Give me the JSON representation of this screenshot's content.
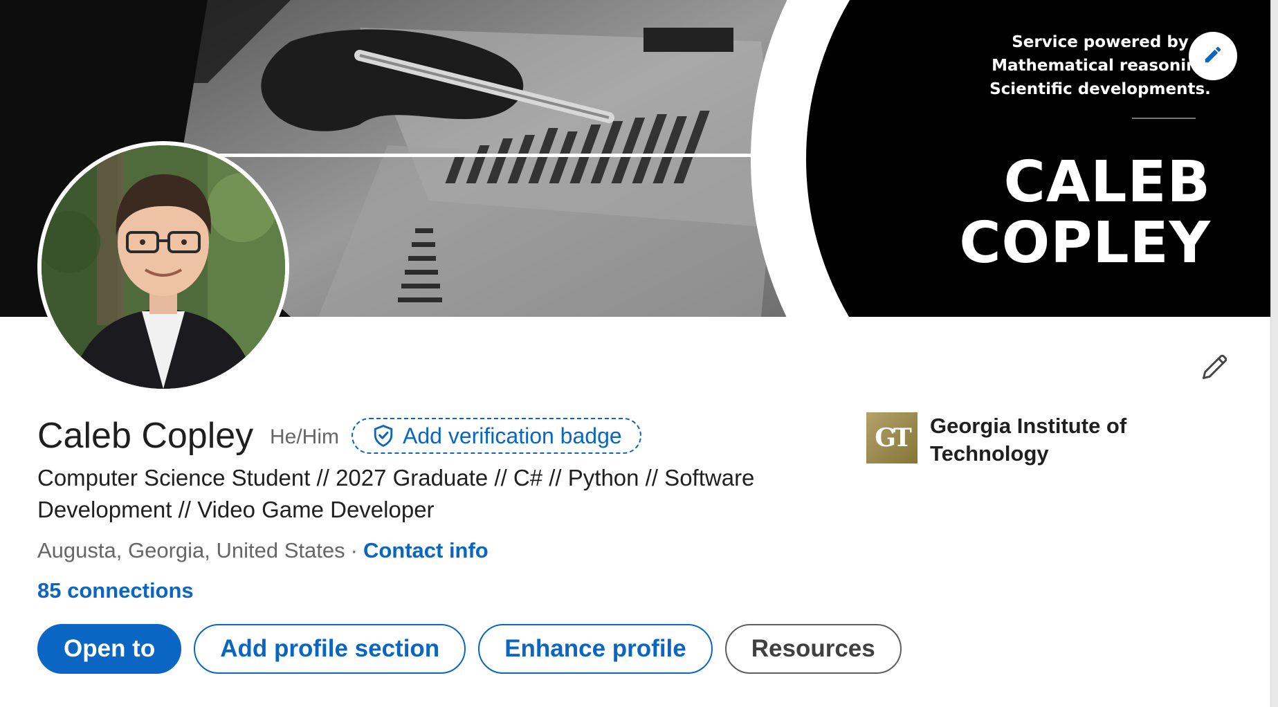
{
  "cover": {
    "tagline_lines": [
      "Service powered by",
      "Mathematical reasoning",
      "Scientific developments."
    ],
    "big_name_lines": [
      "CALEB",
      "COPLEY"
    ],
    "edit_icon": "pencil-icon"
  },
  "profile": {
    "name": "Caleb Copley",
    "pronouns": "He/Him",
    "verification_badge_label": "Add verification badge",
    "headline": "Computer Science Student // 2027 Graduate // C# // Python // Software Development // Video Game Developer",
    "location": "Augusta, Georgia, United States",
    "location_separator": "·",
    "contact_info_label": "Contact info",
    "connections": "85 connections"
  },
  "education": {
    "logo_text": "GT",
    "school_name": "Georgia Institute of Technology"
  },
  "actions": {
    "open_to": "Open to",
    "add_profile_section": "Add profile section",
    "enhance_profile": "Enhance profile",
    "resources": "Resources"
  },
  "colors": {
    "linkedin_blue": "#0a66c2",
    "text_primary": "#1f1f1f",
    "text_secondary": "#666666",
    "gt_gold": "#b3a369"
  }
}
